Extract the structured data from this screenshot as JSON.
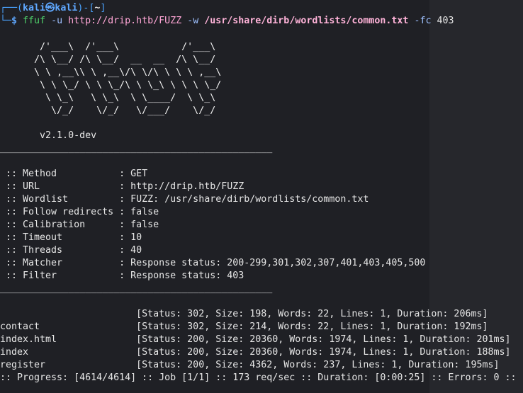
{
  "prompt": {
    "frame_start": "┌──(",
    "user": "kali㉿kali",
    "frame_mid": ")-[",
    "dir": "~",
    "frame_end": "]",
    "frame2": "└─",
    "dollar": "$ ",
    "cmd": "ffuf",
    "arg_u": " -u ",
    "url": "http://drip.htb/FUZZ",
    "arg_w": " -w ",
    "wordlist": "/usr/share/dirb/wordlists/common.txt",
    "arg_fc": " -fc ",
    "fc_val": "403"
  },
  "banner": [
    "       /'___\\  /'___\\           /'___\\",
    "      /\\ \\__/ /\\ \\__/  __  __  /\\ \\__/",
    "      \\ \\ ,__\\\\ \\ ,__\\/\\ \\/\\ \\ \\ \\ ,__\\",
    "       \\ \\ \\_/ \\ \\ \\_/\\ \\ \\_\\ \\ \\ \\ \\_/",
    "        \\ \\_\\   \\ \\_\\  \\ \\____/  \\ \\_\\",
    "         \\/_/    \\/_/   \\/___/    \\/_/"
  ],
  "version": "       v2.1.0-dev",
  "rule": "________________________________________________",
  "config": [
    " :: Method           : GET",
    " :: URL              : http://drip.htb/FUZZ",
    " :: Wordlist         : FUZZ: /usr/share/dirb/wordlists/common.txt",
    " :: Follow redirects : false",
    " :: Calibration      : false",
    " :: Timeout          : 10",
    " :: Threads          : 40",
    " :: Matcher          : Response status: 200-299,301,302,307,401,403,405,500",
    " :: Filter           : Response status: 403"
  ],
  "results": [
    "                        [Status: 302, Size: 198, Words: 22, Lines: 1, Duration: 206ms]",
    "contact                 [Status: 302, Size: 214, Words: 22, Lines: 1, Duration: 192ms]",
    "index.html              [Status: 200, Size: 20360, Words: 1974, Lines: 1, Duration: 201ms]",
    "index                   [Status: 200, Size: 20360, Words: 1974, Lines: 1, Duration: 188ms]",
    "register                [Status: 200, Size: 4362, Words: 237, Lines: 1, Duration: 195ms]"
  ],
  "progress": ":: Progress: [4614/4614] :: Job [1/1] :: 173 req/sec :: Duration: [0:00:25] :: Errors: 0 ::"
}
